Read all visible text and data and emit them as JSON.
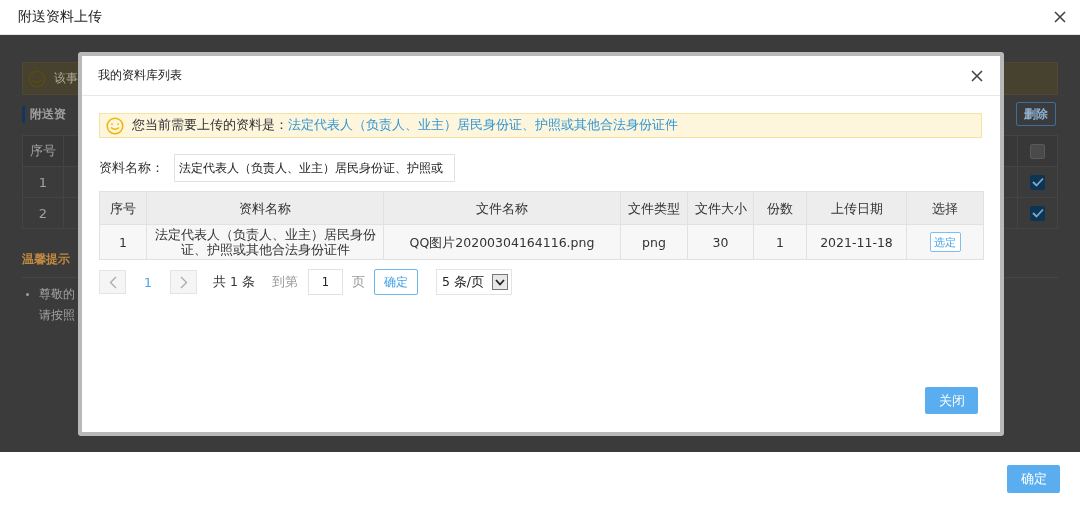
{
  "dialog": {
    "title": "附送资料上传",
    "confirm_button": "确定"
  },
  "background": {
    "notice": "该事",
    "section_title": "附送资",
    "delete_button": "删除",
    "table": {
      "column": "序号",
      "header_checked": false,
      "rows": [
        {
          "seq": "1",
          "checked": true
        },
        {
          "seq": "2",
          "checked": true
        }
      ]
    },
    "tips_title": "温馨提示",
    "tips": [
      "尊敬的",
      "请按照"
    ]
  },
  "modal": {
    "title": "我的资料库列表",
    "notice": {
      "text": "您当前需要上传的资料是：",
      "highlight": "法定代表人（负责人、业主）居民身份证、护照或其他合法身份证件"
    },
    "name_field": {
      "label": "资料名称：",
      "value": "法定代表人（负责人、业主）居民身份证、护照或"
    },
    "table": {
      "columns": [
        "序号",
        "资料名称",
        "文件名称",
        "文件类型",
        "文件大小",
        "份数",
        "上传日期",
        "选择"
      ],
      "rows": [
        {
          "cells": [
            "1",
            "法定代表人（负责人、业主）居民身份证、护照或其他合法身份证件",
            "QQ图片20200304164116.png",
            "png",
            "30",
            "1",
            "2021-11-18"
          ],
          "action": "选定"
        }
      ]
    },
    "pagination": {
      "pages": [
        {
          "label": "1",
          "selected": true
        }
      ],
      "total": "共 1 条",
      "goto_label": "到第",
      "goto_value": "1",
      "page_unit": "页",
      "go_button": "确定",
      "page_size": "5 条/页"
    },
    "close_button": "关闭"
  }
}
